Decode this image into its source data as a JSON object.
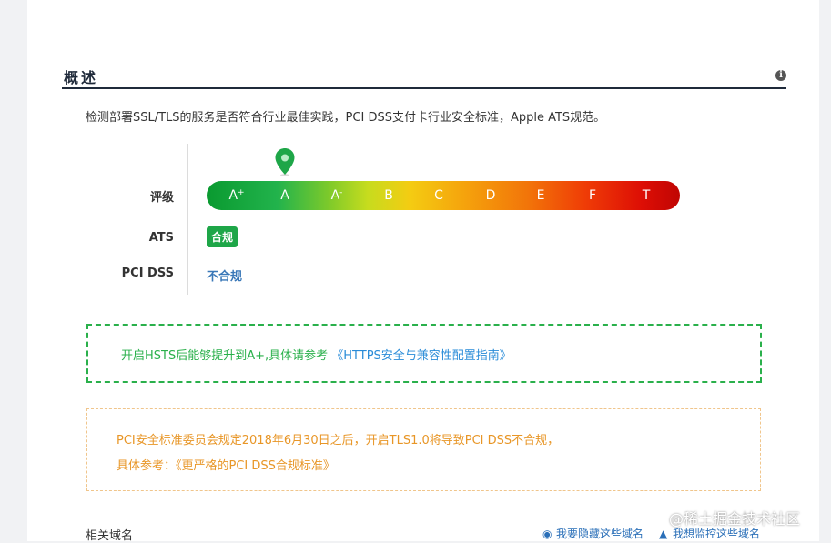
{
  "section": {
    "title": "概述",
    "info_icon": "info-icon"
  },
  "description": "检测部署SSL/TLS的服务是否符合行业最佳实践，PCI DSS支付卡行业安全标准，Apple ATS规范。",
  "rating": {
    "label": "评级",
    "grades": [
      {
        "letter": "A",
        "suffix": "+"
      },
      {
        "letter": "A",
        "suffix": ""
      },
      {
        "letter": "A",
        "suffix": "-"
      },
      {
        "letter": "B",
        "suffix": ""
      },
      {
        "letter": "C",
        "suffix": ""
      },
      {
        "letter": "D",
        "suffix": ""
      },
      {
        "letter": "E",
        "suffix": ""
      },
      {
        "letter": "F",
        "suffix": ""
      },
      {
        "letter": "T",
        "suffix": ""
      }
    ],
    "current_grade_index": 1,
    "marker_icon": "map-pin-icon",
    "marker_color": "#1ea648"
  },
  "ats": {
    "label": "ATS",
    "status": "合规",
    "status_color": "#1ea648"
  },
  "pci": {
    "label": "PCI DSS",
    "status": "不合规",
    "status_color": "#3a78b8"
  },
  "tip_hsts": {
    "text": "开启HSTS后能够提升到A+,具体请参考",
    "link": "《HTTPS安全与兼容性配置指南》",
    "color": "#2ab04b"
  },
  "tip_pci": {
    "line1": "PCI安全标准委员会规定2018年6月30日之后，开启TLS1.0将导致PCI DSS不合规，",
    "line2_prefix": "具体参考：",
    "line2_link": "《更严格的PCI DSS合规标准》",
    "color": "#e89627"
  },
  "footer": {
    "title": "相关域名",
    "hide_link": "我要隐藏这些域名",
    "hide_icon": "eye-icon",
    "monitor_link": "我想监控这些域名",
    "monitor_icon": "bell-icon"
  },
  "watermark": "@稀土掘金技术社区"
}
